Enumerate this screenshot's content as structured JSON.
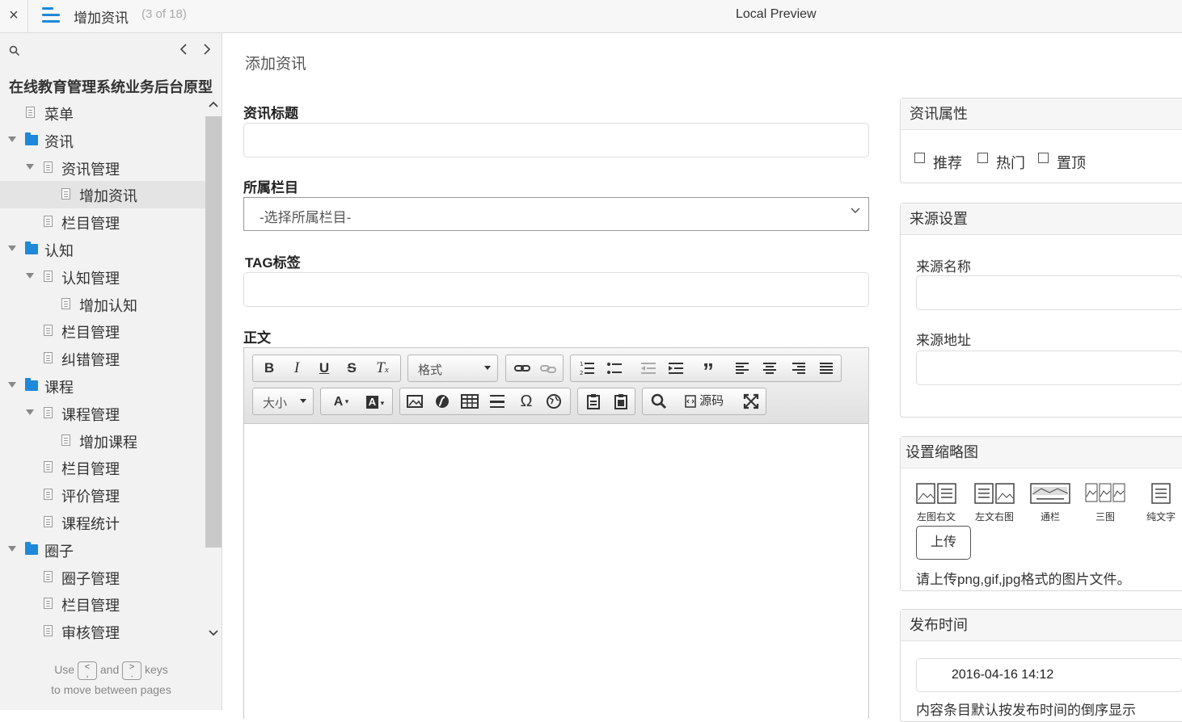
{
  "topbar": {
    "close": "×",
    "page_title": "增加资讯",
    "page_count": "(3 of 18)",
    "preview_label": "Local Preview"
  },
  "sidebar": {
    "project_title": "在线教育管理系统业务后台原型",
    "tree": [
      {
        "label": "菜单",
        "type": "page",
        "level": 0
      },
      {
        "label": "资讯",
        "type": "folder",
        "level": 0
      },
      {
        "label": "资讯管理",
        "type": "page-parent",
        "level": 1
      },
      {
        "label": "增加资讯",
        "type": "page",
        "level": 2,
        "selected": true
      },
      {
        "label": "栏目管理",
        "type": "page",
        "level": 1
      },
      {
        "label": "认知",
        "type": "folder",
        "level": 0
      },
      {
        "label": "认知管理",
        "type": "page-parent",
        "level": 1
      },
      {
        "label": "增加认知",
        "type": "page",
        "level": 2
      },
      {
        "label": "栏目管理",
        "type": "page",
        "level": 1
      },
      {
        "label": "纠错管理",
        "type": "page",
        "level": 1
      },
      {
        "label": "课程",
        "type": "folder",
        "level": 0
      },
      {
        "label": "课程管理",
        "type": "page-parent",
        "level": 1
      },
      {
        "label": "增加课程",
        "type": "page",
        "level": 2
      },
      {
        "label": "栏目管理",
        "type": "page",
        "level": 1
      },
      {
        "label": "评价管理",
        "type": "page",
        "level": 1
      },
      {
        "label": "课程统计",
        "type": "page",
        "level": 1
      },
      {
        "label": "圈子",
        "type": "folder",
        "level": 0
      },
      {
        "label": "圈子管理",
        "type": "page",
        "level": 1
      },
      {
        "label": "栏目管理",
        "type": "page",
        "level": 1
      },
      {
        "label": "审核管理",
        "type": "page",
        "level": 1
      }
    ],
    "hint_use": "Use",
    "hint_prev_key": "<\n,",
    "hint_and": "and",
    "hint_next_key": ">\n.",
    "hint_keys": "keys",
    "hint_line2": "to move between pages"
  },
  "main": {
    "heading": "添加资讯",
    "title_label": "资讯标题",
    "category_label": "所属栏目",
    "category_value": "-选择所属栏目-",
    "tag_label": "TAG标签",
    "body_label": "正文",
    "editor": {
      "format_label": "格式",
      "size_label": "大小",
      "source_label": "源码"
    }
  },
  "panels": {
    "attributes": {
      "title": "资讯属性",
      "options": [
        "推荐",
        "热门",
        "置顶"
      ]
    },
    "source": {
      "title": "来源设置",
      "name_label": "来源名称",
      "url_label": "来源地址"
    },
    "thumbnail": {
      "title": "设置缩略图",
      "layouts": [
        "左图右文",
        "左文右图",
        "通栏",
        "三图",
        "纯文字"
      ],
      "upload_label": "上传",
      "upload_hint": "请上传png,gif,jpg格式的图片文件。"
    },
    "publish": {
      "title": "发布时间",
      "datetime": "2016-04-16  14:12",
      "note": "内容条目默认按发布时间的倒序显示"
    }
  },
  "colors": {
    "accent": "#1f88d8",
    "sidebar_bg": "#f2f2f2",
    "selected_bg": "#e4e4e4"
  }
}
